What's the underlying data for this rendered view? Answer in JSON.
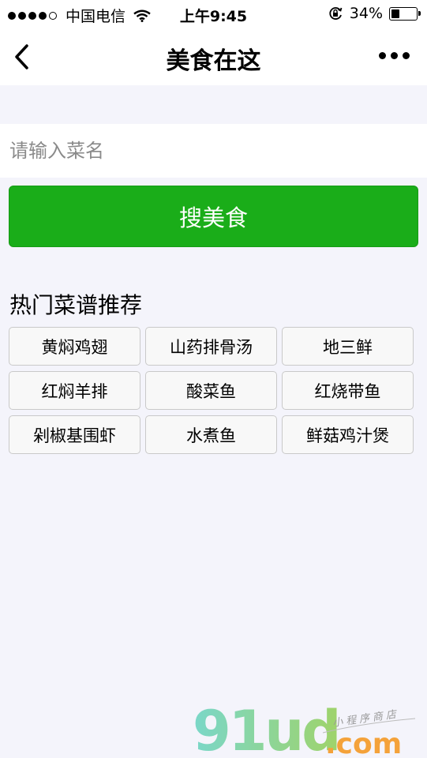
{
  "status_bar": {
    "signal_dots": 5,
    "carrier": "中国电信",
    "time": "上午9:45",
    "battery_percent": "34%",
    "battery_level": 0.34,
    "icons": [
      "signal-icon",
      "wifi-icon",
      "orientation-lock-icon",
      "battery-icon"
    ]
  },
  "nav": {
    "title": "美食在这",
    "back_icon": "chevron-left-icon",
    "more_icon": "more-dots-icon"
  },
  "search": {
    "placeholder": "请输入菜名",
    "value": "",
    "button_label": "搜美食",
    "button_color": "#1aad19"
  },
  "section": {
    "title": "热门菜谱推荐"
  },
  "dishes": [
    "黄焖鸡翅",
    "山药排骨汤",
    "地三鲜",
    "红焖羊排",
    "酸菜鱼",
    "红烧带鱼",
    "剁椒基围虾",
    "水煮鱼",
    "鲜菇鸡汁煲"
  ],
  "watermark": {
    "brand": "91ud",
    "domain": ".com",
    "tagline": "小程序商店"
  }
}
